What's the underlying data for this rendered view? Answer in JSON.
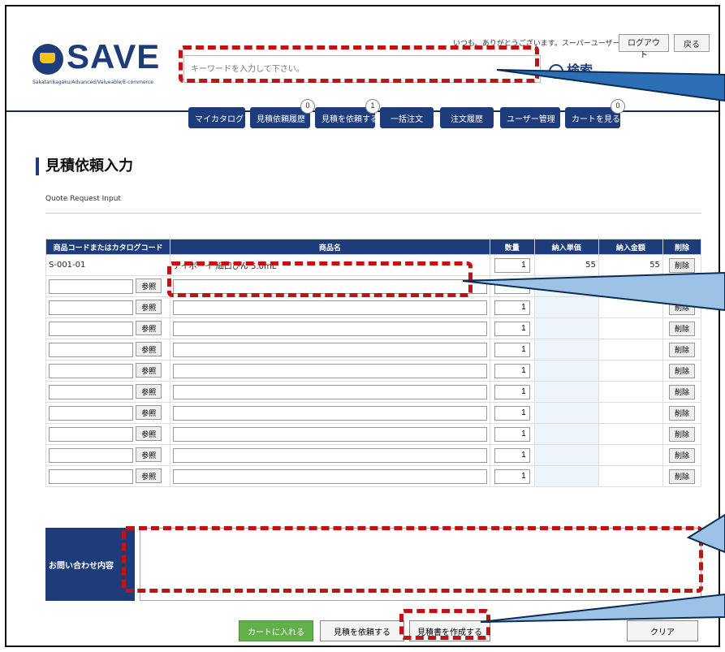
{
  "header": {
    "logo_text": "SAVE",
    "logo_sub": "Sakatarikagaku/Advanced/Valueable/E-commerce",
    "greeting": "いつも、ありがとうございます。スーパーユーザー 様",
    "logout_label": "ログアウト",
    "back_label": "戻る",
    "search_placeholder": "キーワードを入力して下さい。",
    "search_label": "検索"
  },
  "nav": [
    {
      "label": "マイカタログ"
    },
    {
      "label": "見積依頼履歴",
      "badge": "0"
    },
    {
      "label": "見積を依頼する",
      "badge": "1"
    },
    {
      "label": "一括注文"
    },
    {
      "label": "注文履歴"
    },
    {
      "label": "ユーザー管理"
    },
    {
      "label": "カートを見る",
      "badge": "0"
    }
  ],
  "page": {
    "title": "見積依頼入力",
    "subtitle": "Quote Request Input"
  },
  "table": {
    "headers": [
      "商品コードまたはカタログコード",
      "商品名",
      "数量",
      "納入単価",
      "納入金額",
      "削除"
    ],
    "first_row": {
      "code": "S-001-01",
      "name": "アイボーイ 細口びん 5.0mL",
      "qty": "1",
      "unit_price": "55",
      "amount": "55"
    },
    "ref_label": "参照",
    "delete_label": "削除",
    "default_qty": "1"
  },
  "inquiry": {
    "label": "お問い合わせ内容",
    "value": ""
  },
  "buttons": {
    "add_to_cart": "カートに入れる",
    "request_quote": "見積を依頼する",
    "create_quote": "見積書を作成する",
    "clear": "クリア"
  },
  "colors": {
    "brand": "#1f3c7a",
    "annotation": "#c21212",
    "green": "#62b04a"
  }
}
